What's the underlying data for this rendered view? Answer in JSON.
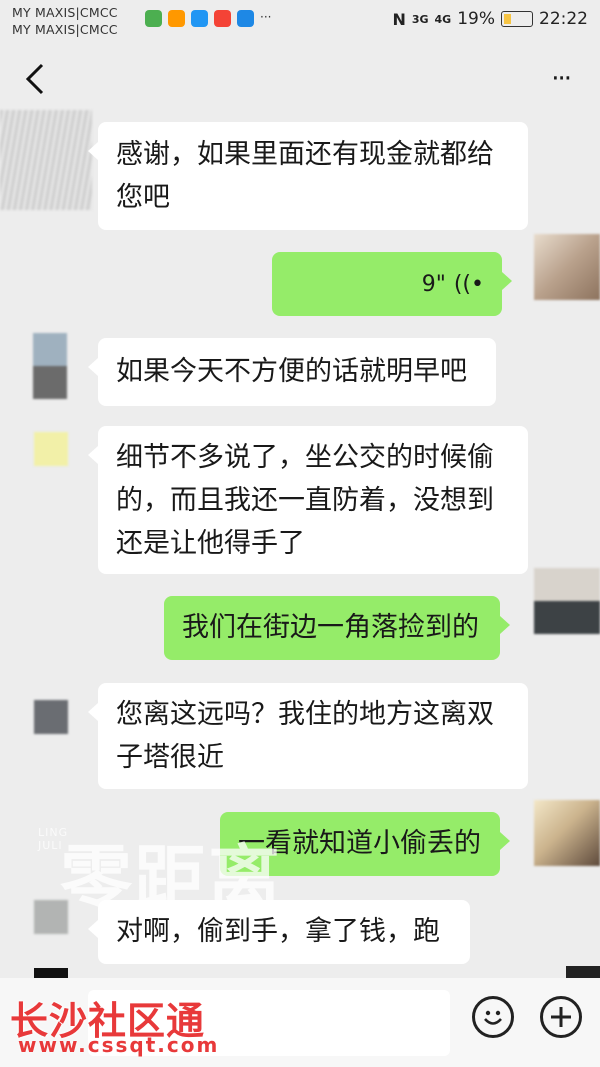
{
  "status_bar": {
    "carrier_1": "MY MAXIS|CMCC",
    "carrier_2": "MY MAXIS|CMCC",
    "more_notifications": "···",
    "nfc": "N",
    "signal_1": "3G",
    "signal_2": "4G",
    "battery": "19%",
    "time": "22:22"
  },
  "nav": {
    "back_icon": "chevron-left-icon",
    "more_label": "···"
  },
  "messages": [
    {
      "side": "in",
      "text": "感谢，如果里面还有现金就都给\n您吧"
    },
    {
      "side": "out",
      "type": "voice",
      "duration": "9\""
    },
    {
      "side": "in",
      "text": "如果今天不方便的话就明早吧"
    },
    {
      "side": "in",
      "text": "细节不多说了，坐公交的时候偷\n的，而且我还一直防着，没想到\n还是让他得手了"
    },
    {
      "side": "out",
      "text": "我们在街边一角落捡到的"
    },
    {
      "side": "in",
      "text": "您离这远吗？我住的地方这离双\n子塔很近"
    },
    {
      "side": "out",
      "text": "一看就知道小偷丢的"
    },
    {
      "side": "in",
      "text": "对啊，偷到手，拿了钱，跑"
    }
  ],
  "watermark": {
    "main": "零距离",
    "sub": "LING JULI"
  },
  "input_bar": {
    "emoji_icon": "emoji-icon",
    "plus_icon": "plus-icon"
  },
  "brand": {
    "name": "长沙社区通",
    "url": "www.cssqt.com"
  },
  "colors": {
    "outgoing_bubble": "#95ec69",
    "incoming_bubble": "#ffffff",
    "background": "#ededed",
    "brand_red": "#e8393a"
  }
}
